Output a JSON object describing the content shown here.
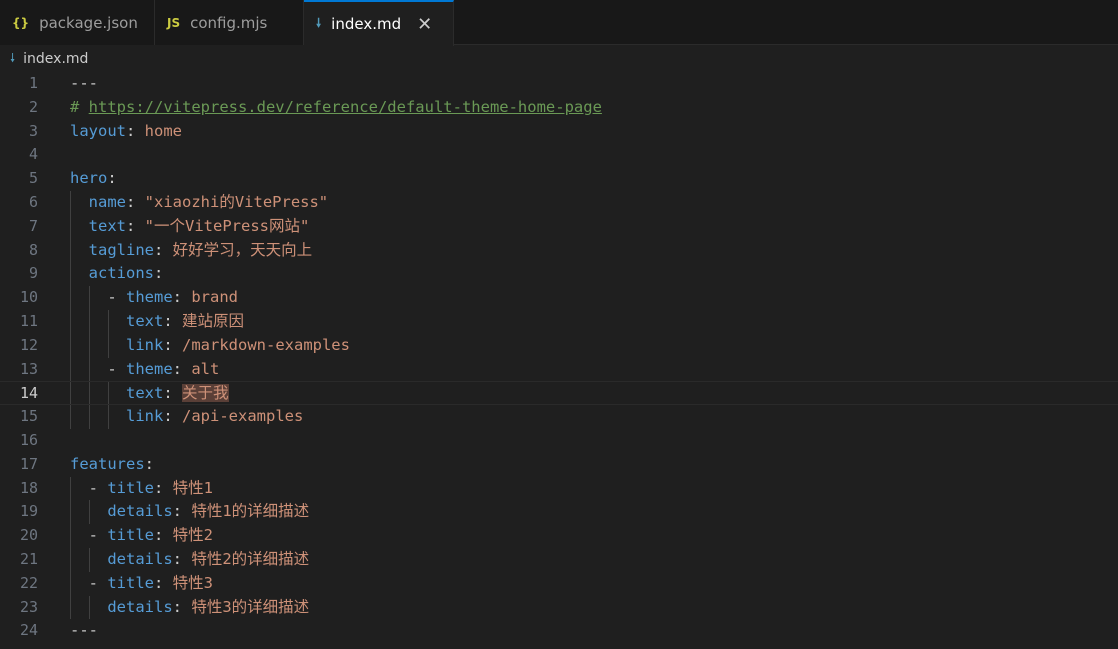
{
  "tabs": [
    {
      "icon": "{}",
      "label": "package.json",
      "active": false
    },
    {
      "icon": "JS",
      "label": "config.mjs",
      "active": false
    },
    {
      "icon": "🠗",
      "label": "index.md",
      "active": true,
      "close": "✕"
    }
  ],
  "breadcrumb": {
    "file": "index.md"
  },
  "editor": {
    "current_line": 14,
    "lines": [
      {
        "n": "1",
        "parts": [
          [
            "p",
            "---"
          ]
        ]
      },
      {
        "n": "2",
        "parts": [
          [
            "c",
            "# "
          ],
          [
            "cu",
            "https://vitepress.dev/reference/default-theme-home-page"
          ]
        ]
      },
      {
        "n": "3",
        "parts": [
          [
            "k",
            "layout"
          ],
          [
            "p",
            ": "
          ],
          [
            "s",
            "home"
          ]
        ]
      },
      {
        "n": "4",
        "parts": []
      },
      {
        "n": "5",
        "parts": [
          [
            "k",
            "hero"
          ],
          [
            "p",
            ":"
          ]
        ]
      },
      {
        "n": "6",
        "parts": [
          [
            "p",
            "  "
          ],
          [
            "k",
            "name"
          ],
          [
            "p",
            ": "
          ],
          [
            "s",
            "\"xiaozhi的VitePress\""
          ]
        ]
      },
      {
        "n": "7",
        "parts": [
          [
            "p",
            "  "
          ],
          [
            "k",
            "text"
          ],
          [
            "p",
            ": "
          ],
          [
            "s",
            "\"一个VitePress网站\""
          ]
        ]
      },
      {
        "n": "8",
        "parts": [
          [
            "p",
            "  "
          ],
          [
            "k",
            "tagline"
          ],
          [
            "p",
            ": "
          ],
          [
            "s",
            "好好学习，天天向上"
          ]
        ]
      },
      {
        "n": "9",
        "parts": [
          [
            "p",
            "  "
          ],
          [
            "k",
            "actions"
          ],
          [
            "p",
            ":"
          ]
        ]
      },
      {
        "n": "10",
        "parts": [
          [
            "p",
            "    - "
          ],
          [
            "k",
            "theme"
          ],
          [
            "p",
            ": "
          ],
          [
            "s",
            "brand"
          ]
        ]
      },
      {
        "n": "11",
        "parts": [
          [
            "p",
            "      "
          ],
          [
            "k",
            "text"
          ],
          [
            "p",
            ": "
          ],
          [
            "s",
            "建站原因"
          ]
        ]
      },
      {
        "n": "12",
        "parts": [
          [
            "p",
            "      "
          ],
          [
            "k",
            "link"
          ],
          [
            "p",
            ": "
          ],
          [
            "s",
            "/markdown-examples"
          ]
        ]
      },
      {
        "n": "13",
        "parts": [
          [
            "p",
            "    - "
          ],
          [
            "k",
            "theme"
          ],
          [
            "p",
            ": "
          ],
          [
            "s",
            "alt"
          ]
        ]
      },
      {
        "n": "14",
        "parts": [
          [
            "p",
            "      "
          ],
          [
            "k",
            "text"
          ],
          [
            "p",
            ": "
          ],
          [
            "sh",
            "关于我"
          ]
        ]
      },
      {
        "n": "15",
        "parts": [
          [
            "p",
            "      "
          ],
          [
            "k",
            "link"
          ],
          [
            "p",
            ": "
          ],
          [
            "s",
            "/api-examples"
          ]
        ]
      },
      {
        "n": "16",
        "parts": []
      },
      {
        "n": "17",
        "parts": [
          [
            "k",
            "features"
          ],
          [
            "p",
            ":"
          ]
        ]
      },
      {
        "n": "18",
        "parts": [
          [
            "p",
            "  - "
          ],
          [
            "k",
            "title"
          ],
          [
            "p",
            ": "
          ],
          [
            "s",
            "特性1"
          ]
        ]
      },
      {
        "n": "19",
        "parts": [
          [
            "p",
            "    "
          ],
          [
            "k",
            "details"
          ],
          [
            "p",
            ": "
          ],
          [
            "s",
            "特性1的详细描述"
          ]
        ]
      },
      {
        "n": "20",
        "parts": [
          [
            "p",
            "  - "
          ],
          [
            "k",
            "title"
          ],
          [
            "p",
            ": "
          ],
          [
            "s",
            "特性2"
          ]
        ]
      },
      {
        "n": "21",
        "parts": [
          [
            "p",
            "    "
          ],
          [
            "k",
            "details"
          ],
          [
            "p",
            ": "
          ],
          [
            "s",
            "特性2的详细描述"
          ]
        ]
      },
      {
        "n": "22",
        "parts": [
          [
            "p",
            "  - "
          ],
          [
            "k",
            "title"
          ],
          [
            "p",
            ": "
          ],
          [
            "s",
            "特性3"
          ]
        ]
      },
      {
        "n": "23",
        "parts": [
          [
            "p",
            "    "
          ],
          [
            "k",
            "details"
          ],
          [
            "p",
            ": "
          ],
          [
            "s",
            "特性3的详细描述"
          ]
        ]
      },
      {
        "n": "24",
        "parts": [
          [
            "p",
            "---"
          ]
        ]
      }
    ]
  },
  "colors": {
    "keyword": "#569cd6",
    "string": "#ce9178",
    "comment": "#6a9955",
    "accent": "#0078d4"
  }
}
